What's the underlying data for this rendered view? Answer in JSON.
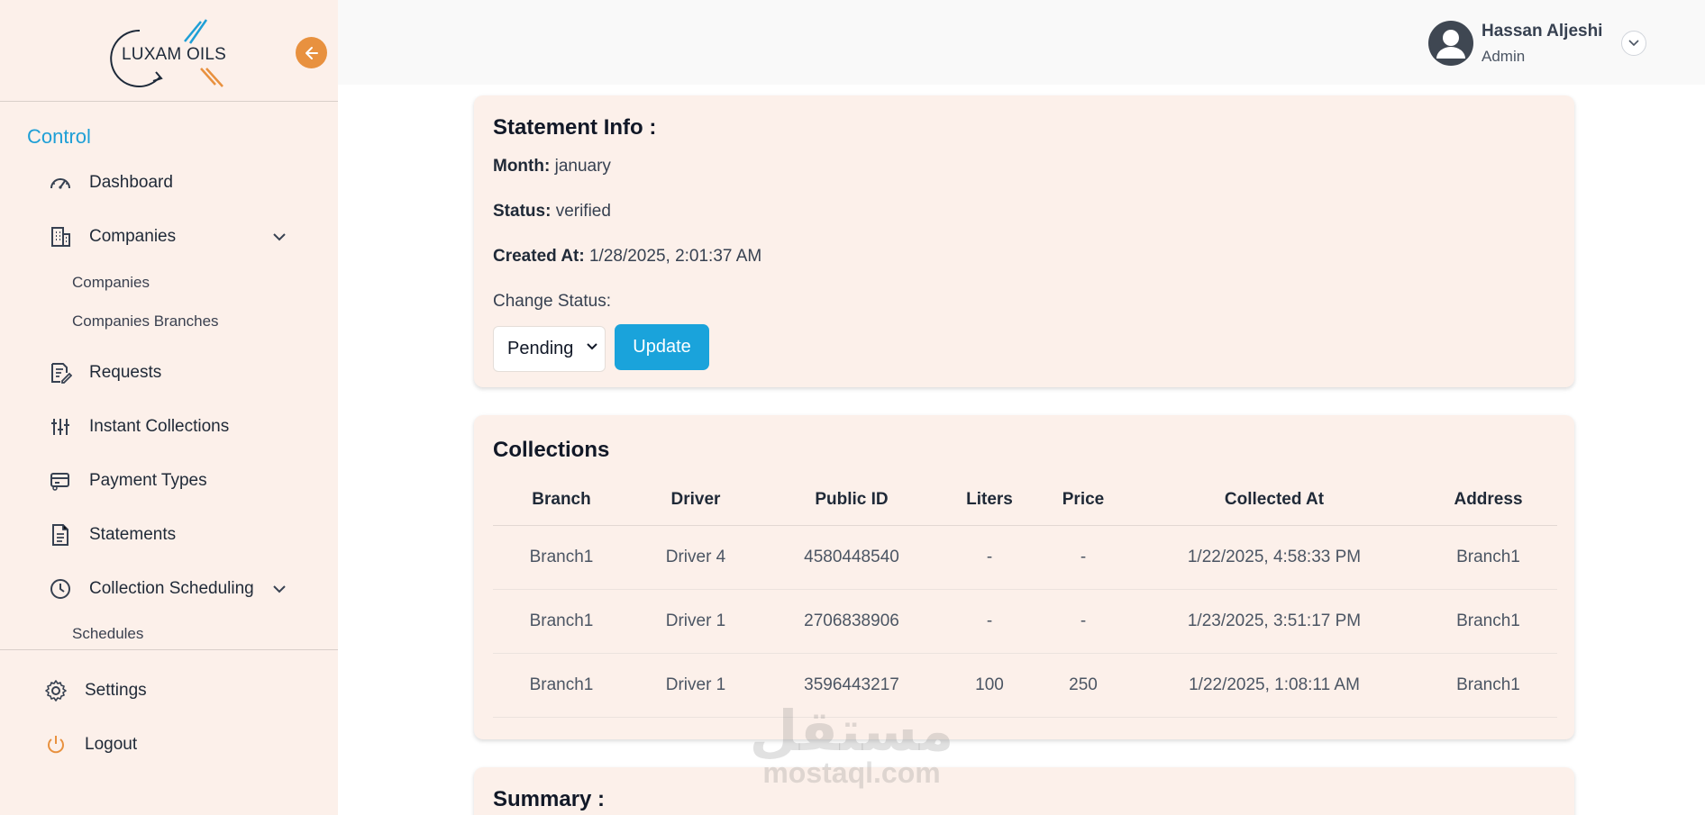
{
  "brand": {
    "logo_text": "LUXAM OILS",
    "accent": "#e8913f",
    "primary": "#1aa3db"
  },
  "sidebar": {
    "section_title": "Control",
    "items": [
      {
        "label": "Dashboard"
      },
      {
        "label": "Companies"
      },
      {
        "label": "Requests"
      },
      {
        "label": "Instant Collections"
      },
      {
        "label": "Payment Types"
      },
      {
        "label": "Statements"
      },
      {
        "label": "Collection Scheduling"
      }
    ],
    "companies_sub": [
      "Companies",
      "Companies Branches"
    ],
    "scheduling_sub": [
      "Schedules"
    ],
    "bottom": [
      {
        "label": "Settings"
      },
      {
        "label": "Logout"
      }
    ]
  },
  "user": {
    "name": "Hassan Aljeshi",
    "role": "Admin"
  },
  "statement": {
    "title": "Statement Info :",
    "month_label": "Month:",
    "month_value": "january",
    "status_label": "Status:",
    "status_value": "verified",
    "created_label": "Created At:",
    "created_value": "1/28/2025, 2:01:37 AM",
    "change_status_label": "Change Status:",
    "select_value": "Pending",
    "update_label": "Update"
  },
  "collections": {
    "title": "Collections",
    "columns": [
      "Branch",
      "Driver",
      "Public ID",
      "Liters",
      "Price",
      "Collected At",
      "Address"
    ],
    "rows": [
      [
        "Branch1",
        "Driver 4",
        "4580448540",
        "-",
        "-",
        "1/22/2025, 4:58:33 PM",
        "Branch1"
      ],
      [
        "Branch1",
        "Driver 1",
        "2706838906",
        "-",
        "-",
        "1/23/2025, 3:51:17 PM",
        "Branch1"
      ],
      [
        "Branch1",
        "Driver 1",
        "3596443217",
        "100",
        "250",
        "1/22/2025, 1:08:11 AM",
        "Branch1"
      ]
    ]
  },
  "summary": {
    "title": "Summary :"
  },
  "watermark": {
    "arabic": "مستقل",
    "latin": "mostaql.com"
  }
}
